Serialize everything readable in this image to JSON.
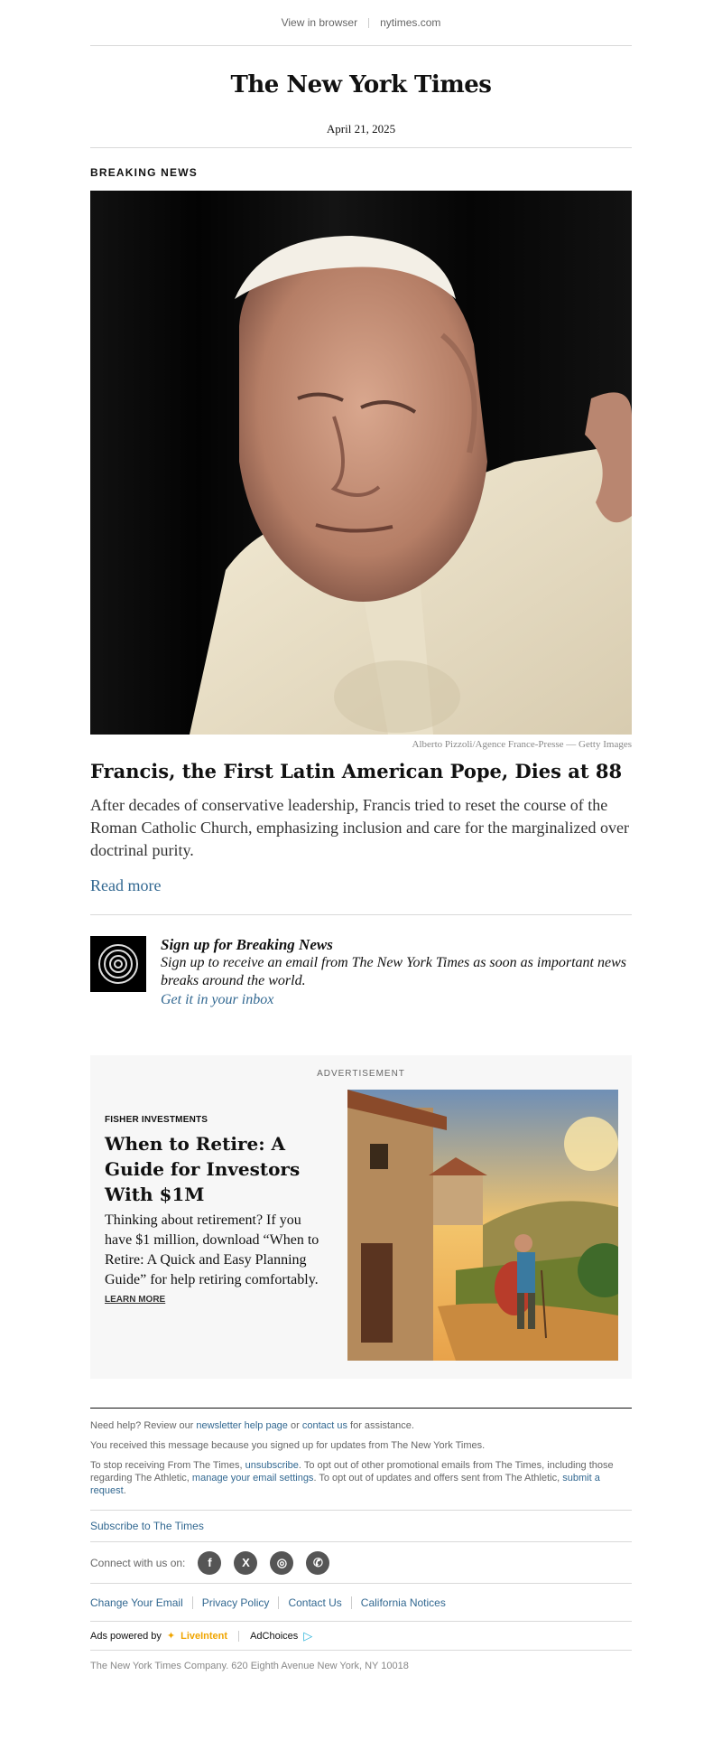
{
  "topbar": {
    "view_in_browser": "View in browser",
    "site": "nytimes.com"
  },
  "masthead": {
    "logo": "The New York Times",
    "date": "April 21, 2025"
  },
  "article": {
    "kicker": "BREAKING NEWS",
    "photo_credit": "Alberto Pizzoli/Agence France-Presse — Getty Images",
    "headline": "Francis, the First Latin American Pope, Dies at 88",
    "summary": "After decades of conservative leadership, Francis tried to reset the course of the Roman Catholic Church, emphasizing inclusion and care for the marginalized over doctrinal purity.",
    "read_more": "Read more"
  },
  "signup": {
    "title": "Sign up for Breaking News",
    "description": "Sign up to receive an email from The New York Times as soon as important news breaks around the world.",
    "link": "Get it in your inbox"
  },
  "ad": {
    "label": "ADVERTISEMENT",
    "sponsor": "FISHER INVESTMENTS",
    "title": "When to Retire: A Guide for Investors With $1M",
    "body": "Thinking about retirement? If you have $1 million, download “When to Retire: A Quick and Easy Planning Guide” for help retiring comfortably.",
    "cta": "LEARN MORE"
  },
  "footer": {
    "help_prefix": "Need help? Review our ",
    "help_link1": "newsletter help page",
    "help_mid": " or ",
    "help_link2": "contact us",
    "help_suffix": " for assistance.",
    "reason": "You received this message because you signed up for updates from The New York Times.",
    "stop_prefix": "To stop receiving From The Times, ",
    "stop_unsubscribe": "unsubscribe",
    "stop_mid": ". To opt out of other promotional emails from The Times, including those regarding The Athletic, ",
    "stop_manage": "manage your email settings",
    "stop_mid2": ". To opt out of updates and offers sent from The Athletic, ",
    "stop_request": "submit a request",
    "stop_end": ".",
    "subscribe": "Subscribe to The Times",
    "connect_label": "Connect with us on:",
    "social": [
      {
        "icon": "facebook-icon",
        "glyph": "f"
      },
      {
        "icon": "x-icon",
        "glyph": "X"
      },
      {
        "icon": "instagram-icon",
        "glyph": "◎"
      },
      {
        "icon": "whatsapp-icon",
        "glyph": "✆"
      }
    ],
    "links": [
      "Change Your Email",
      "Privacy Policy",
      "Contact Us",
      "California Notices"
    ],
    "ads_powered_by": "Ads powered by",
    "liveintent": "LiveIntent",
    "adchoices": "AdChoices",
    "address": "The New York Times Company. 620 Eighth Avenue New York, NY 10018"
  },
  "colors": {
    "link": "#326891",
    "ad_background": "#f7f7f7",
    "liveintent": "#f0a500"
  }
}
